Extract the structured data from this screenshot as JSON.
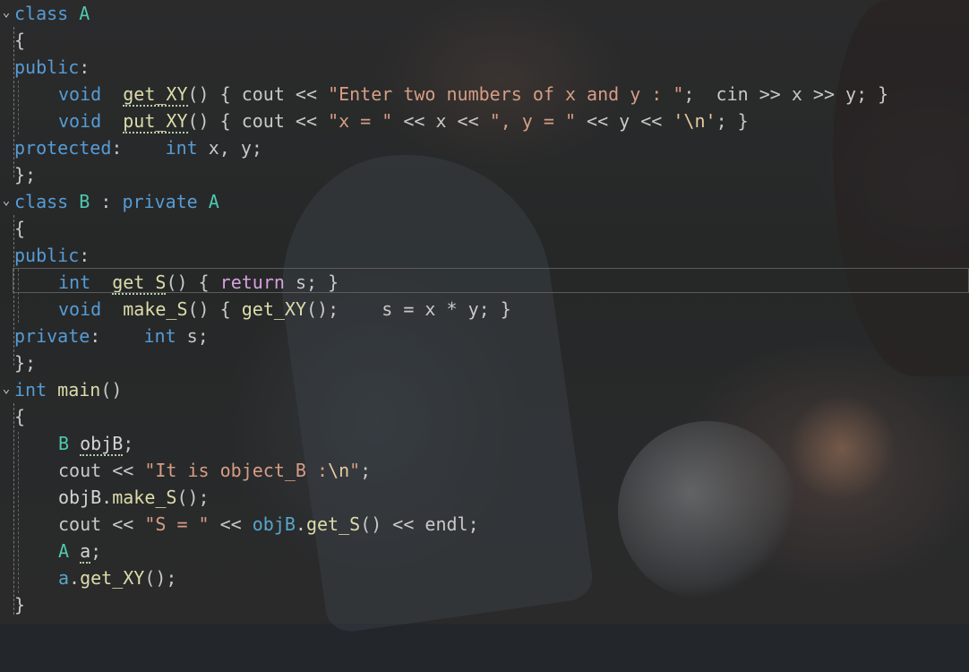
{
  "window": {
    "accent_keyword": "#569cd6",
    "accent_type": "#4ec9b0",
    "accent_string": "#d69d85",
    "accent_function": "#dcdcaa",
    "accent_control": "#d8a0df"
  },
  "code": {
    "l1": {
      "fold": "⌄",
      "t1": "class",
      "t2": "A"
    },
    "l2": {
      "t1": "{"
    },
    "l3": {
      "t1": "public",
      "t2": ":"
    },
    "l4": {
      "t1": "void",
      "t2": "get_XY",
      "t3": "() { cout << ",
      "t4": "\"Enter two numbers of x and y : \"",
      "t5": ";  cin >> x >> y; }"
    },
    "l5": {
      "t1": "void",
      "t2": "put_XY",
      "t3": "() { cout << ",
      "t4": "\"x = \"",
      "t5": " << x << ",
      "t6": "\", y = \"",
      "t7": " << y << ",
      "t8": "'\\n'",
      "t9": "; }"
    },
    "l6": {
      "t1": "protected",
      "t2": ":",
      "t3": "int",
      "t4": " x, y;"
    },
    "l7": {
      "t1": "};"
    },
    "l8": {
      "fold": "⌄",
      "t1": "class",
      "t2": "B",
      "t3": " : ",
      "t4": "private",
      "t5": "A"
    },
    "l9": {
      "t1": "{"
    },
    "l10": {
      "t1": "public",
      "t2": ":"
    },
    "l11": {
      "t1": "int",
      "t2": "get_S",
      "t3": "() { ",
      "t4": "return",
      "t5": " s; }"
    },
    "l12": {
      "t1": "void",
      "t2": "make_S",
      "t3": "() { ",
      "t4": "get_XY",
      "t5": "();    s = x * y; }"
    },
    "l13": {
      "t1": "private",
      "t2": ":",
      "t3": "int",
      "t4": " s;"
    },
    "l14": {
      "t1": "};"
    },
    "l15": {
      "fold": "⌄",
      "t1": "int",
      "t2": "main",
      "t3": "()"
    },
    "l16": {
      "t1": "{"
    },
    "l17": {
      "t1": "B",
      "t2": "objB",
      "t3": ";"
    },
    "l18": {
      "t1": "cout << ",
      "t2": "\"It is object_B :",
      "t3": "\\n",
      "t4": "\"",
      "t5": ";"
    },
    "l19": {
      "t1": "objB",
      "t2": ".",
      "t3": "make_S",
      "t4": "();"
    },
    "l20": {
      "t1": "cout << ",
      "t2": "\"S = \"",
      "t3": " << ",
      "t4": "objB",
      "t5": ".",
      "t6": "get_S",
      "t7": "() << endl;"
    },
    "l21": {
      "t1": "A",
      "t2": "a",
      "t3": ";"
    },
    "l22": {
      "t1": "a",
      "t2": ".",
      "t3": "get_XY",
      "t4": "();"
    },
    "l23": {
      "t1": "}"
    }
  }
}
